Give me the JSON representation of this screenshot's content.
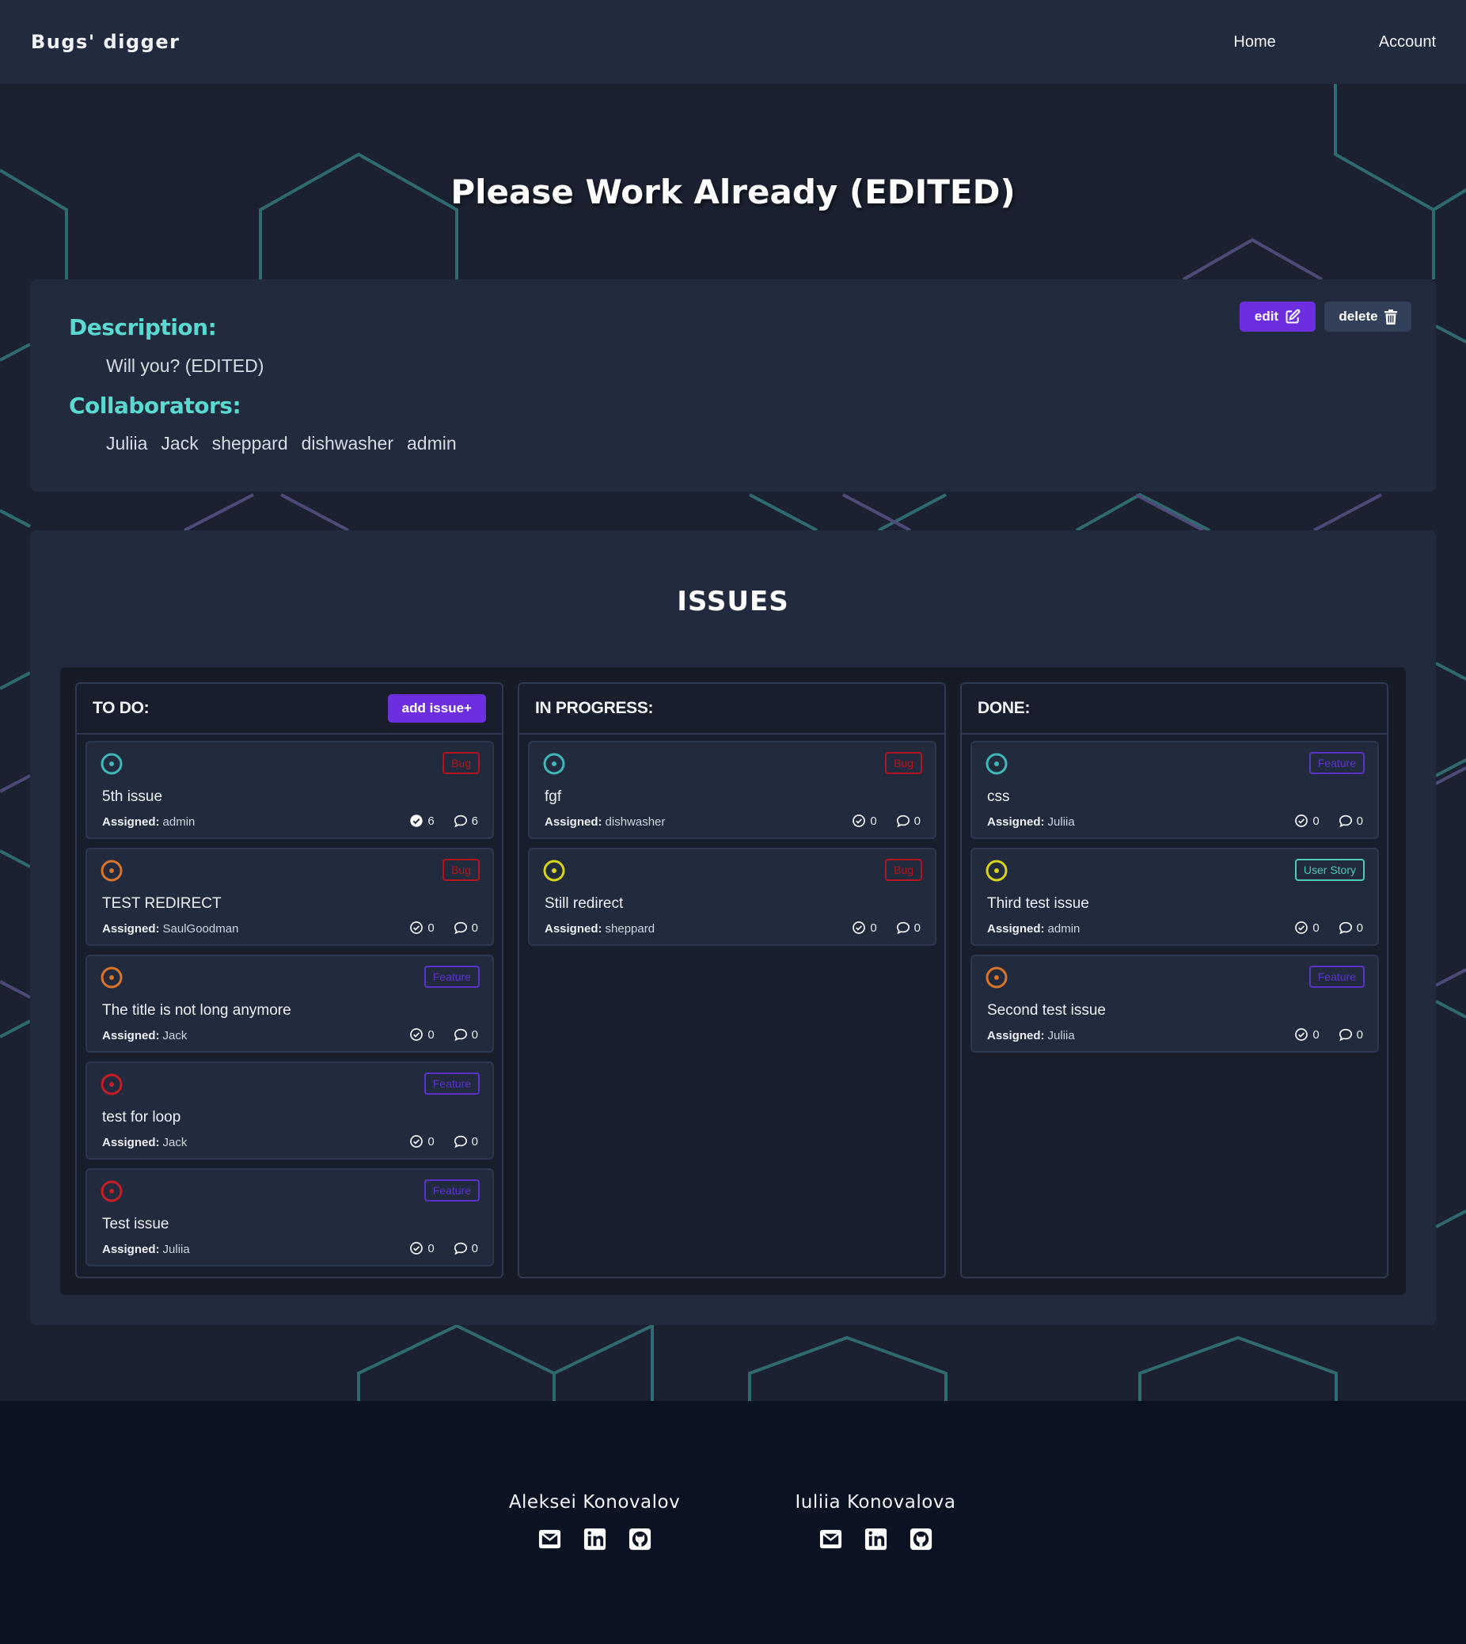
{
  "navbar": {
    "brand": "Bugs' digger",
    "links": [
      "Home",
      "Account"
    ]
  },
  "project": {
    "title": "Please Work Already (EDITED)",
    "description_label": "Description:",
    "description": "Will you? (EDITED)",
    "collaborators_label": "Collaborators:",
    "collaborators": [
      "Juliia",
      "Jack",
      "sheppard",
      "dishwasher",
      "admin"
    ],
    "edit_label": "edit",
    "delete_label": "delete"
  },
  "issues": {
    "heading": "ISSUES",
    "add_issue_label": "add issue+",
    "assigned_label": "Assigned:",
    "columns": [
      {
        "title": "TO DO:",
        "items": [
          {
            "title": "5th issue",
            "assignee": "admin",
            "tag": "Bug",
            "priority": "low",
            "checks": "6",
            "comments": "6",
            "checks_filled": true
          },
          {
            "title": "TEST REDIRECT",
            "assignee": "SaulGoodman",
            "tag": "Bug",
            "priority": "medium",
            "checks": "0",
            "comments": "0",
            "checks_filled": false
          },
          {
            "title": "The title is not long anymore",
            "assignee": "Jack",
            "tag": "Feature",
            "priority": "medium",
            "checks": "0",
            "comments": "0",
            "checks_filled": false
          },
          {
            "title": "test for loop",
            "assignee": "Jack",
            "tag": "Feature",
            "priority": "high",
            "checks": "0",
            "comments": "0",
            "checks_filled": false
          },
          {
            "title": "Test issue",
            "assignee": "Juliia",
            "tag": "Feature",
            "priority": "high",
            "checks": "0",
            "comments": "0",
            "checks_filled": false
          }
        ]
      },
      {
        "title": "IN PROGRESS:",
        "items": [
          {
            "title": "fgf",
            "assignee": "dishwasher",
            "tag": "Bug",
            "priority": "low",
            "checks": "0",
            "comments": "0",
            "checks_filled": false
          },
          {
            "title": "Still redirect",
            "assignee": "sheppard",
            "tag": "Bug",
            "priority": "normal",
            "checks": "0",
            "comments": "0",
            "checks_filled": false
          }
        ]
      },
      {
        "title": "DONE:",
        "items": [
          {
            "title": "css",
            "assignee": "Juliia",
            "tag": "Feature",
            "priority": "low",
            "checks": "0",
            "comments": "0",
            "checks_filled": false
          },
          {
            "title": "Third test issue",
            "assignee": "admin",
            "tag": "User Story",
            "priority": "normal",
            "checks": "0",
            "comments": "0",
            "checks_filled": false
          },
          {
            "title": "Second test issue",
            "assignee": "Juliia",
            "tag": "Feature",
            "priority": "medium",
            "checks": "0",
            "comments": "0",
            "checks_filled": false
          }
        ]
      }
    ]
  },
  "footer": {
    "authors": [
      {
        "name": "Aleksei Konovalov",
        "icons": [
          "envelope-icon",
          "linkedin-icon",
          "github-icon"
        ]
      },
      {
        "name": "Iuliia Konovalova",
        "icons": [
          "envelope-icon",
          "linkedin-icon",
          "github-icon"
        ]
      }
    ]
  },
  "colors": {
    "accent_purple": "#6d2ee0",
    "heading_teal": "#5ad9d0",
    "priority_low": "#3fb8b8",
    "priority_medium": "#d9742a",
    "priority_high": "#c61c25",
    "priority_normal": "#d8d41a",
    "tag_bug": "#b3141d",
    "tag_feature": "#5a34c8",
    "tag_user_story": "#4fc9b8"
  }
}
